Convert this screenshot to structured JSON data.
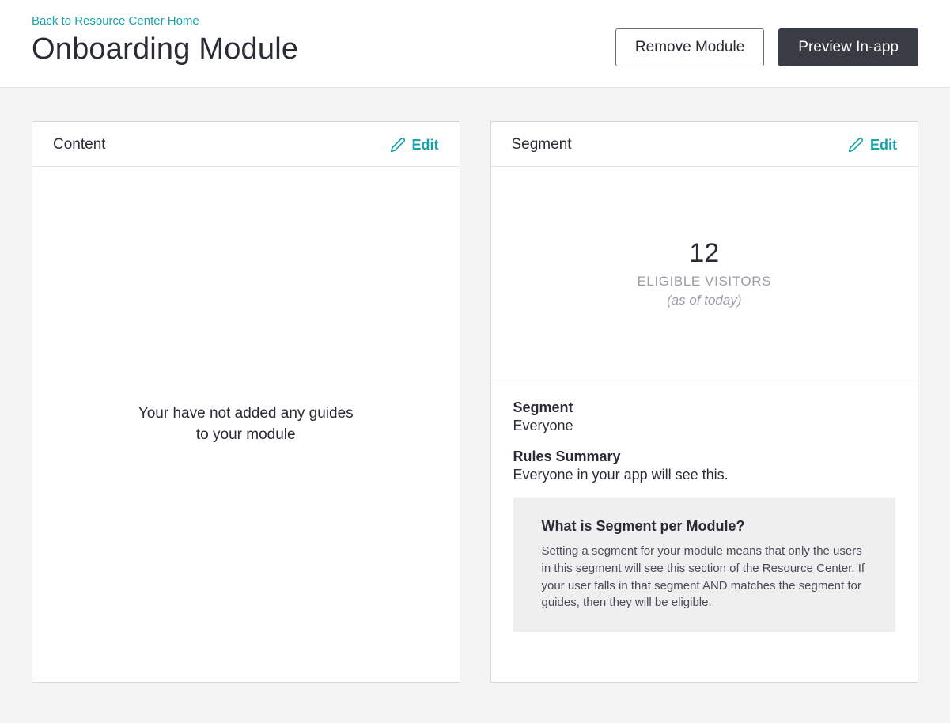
{
  "header": {
    "back_link": "Back to Resource Center Home",
    "title": "Onboarding Module",
    "remove_button": "Remove Module",
    "preview_button": "Preview In-app"
  },
  "content_card": {
    "title": "Content",
    "edit_label": "Edit",
    "empty_line1": "Your have not added any guides",
    "empty_line2": "to your module"
  },
  "segment_card": {
    "title": "Segment",
    "edit_label": "Edit",
    "stat_number": "12",
    "stat_label": "ELIGIBLE VISITORS",
    "stat_sub": "(as of today)",
    "segment_label": "Segment",
    "segment_value": "Everyone",
    "rules_label": "Rules Summary",
    "rules_value": "Everyone in your app will see this.",
    "info_title": "What is Segment per Module?",
    "info_text": "Setting a segment for your module means that only the users in this segment will see this section of the Resource Center. If your user falls in that segment AND matches the segment for guides, then they will be eligible."
  }
}
